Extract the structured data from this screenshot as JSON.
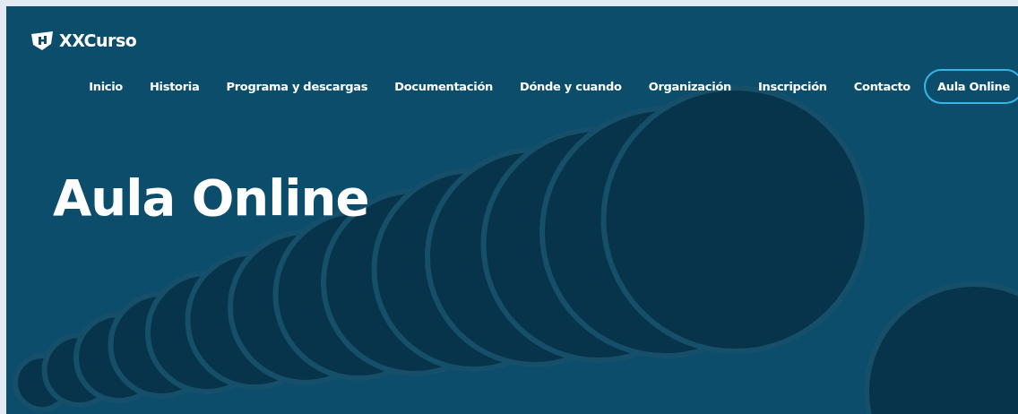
{
  "logo": {
    "text": "XXCurso"
  },
  "nav": [
    {
      "label": "Inicio",
      "selected": false
    },
    {
      "label": "Historia",
      "selected": false
    },
    {
      "label": "Programa y descargas",
      "selected": false
    },
    {
      "label": "Documentación",
      "selected": false
    },
    {
      "label": "Dónde y cuando",
      "selected": false
    },
    {
      "label": "Organización",
      "selected": false
    },
    {
      "label": "Inscripción",
      "selected": false
    },
    {
      "label": "Contacto",
      "selected": false
    },
    {
      "label": "Aula Online",
      "selected": true
    }
  ],
  "hero": {
    "title": "Aula Online"
  }
}
